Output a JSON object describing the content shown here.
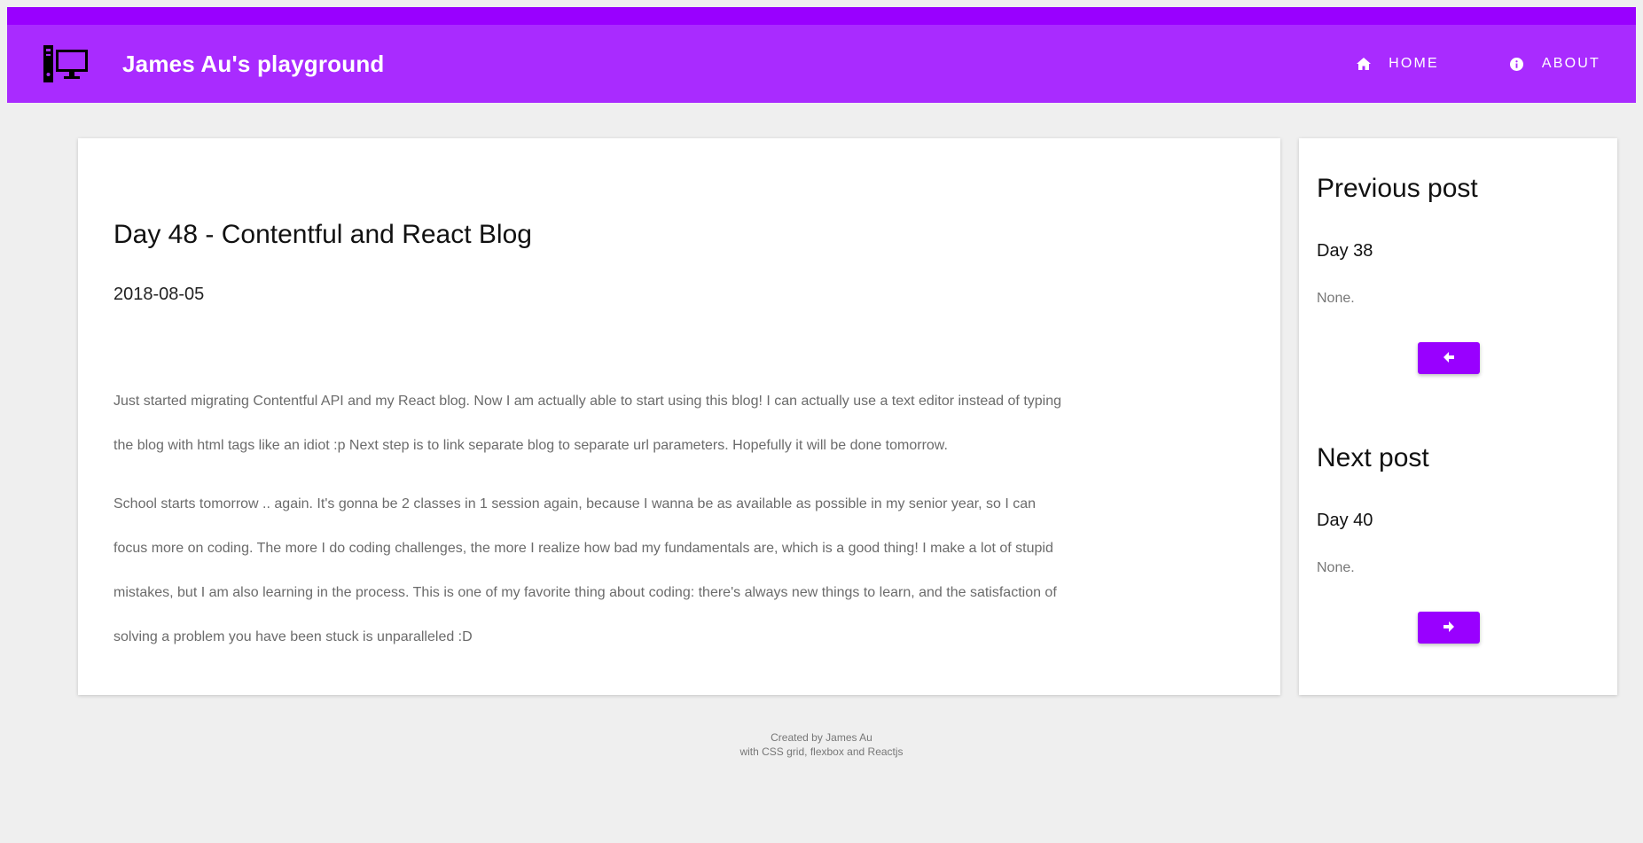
{
  "header": {
    "logo_icon": "desktop-computer-icon",
    "title": "James Au's playground",
    "nav": [
      {
        "label": "HOME",
        "icon": "home-icon"
      },
      {
        "label": "ABOUT",
        "icon": "info-circle-icon"
      }
    ]
  },
  "post": {
    "title": "Day 48 - Contentful and React Blog",
    "date": "2018-08-05",
    "paragraphs": [
      "Just started migrating Contentful API and my React blog. Now I am actually able to start using this blog! I can actually use a text editor instead of typing the blog with html tags like an idiot :p Next step is to link separate blog to separate url parameters. Hopefully it will be done tomorrow.",
      "School starts tomorrow .. again. It's gonna be 2 classes in 1 session again, because I wanna be as available as possible in my senior year, so I can focus more on coding. The more I do coding challenges, the more I realize how bad my fundamentals are, which is a good thing! I make a lot of stupid mistakes, but I am also learning in the process. This is one of my favorite thing about coding: there's always new things to learn, and the satisfaction of solving a problem you have been stuck is unparalleled :D"
    ]
  },
  "sidebar": {
    "previous": {
      "heading": "Previous post",
      "title": "Day 38",
      "summary": "None.",
      "button_icon": "arrow-left-icon"
    },
    "next": {
      "heading": "Next post",
      "title": "Day 40",
      "summary": "None.",
      "button_icon": "arrow-right-icon"
    }
  },
  "footer": {
    "line1": "Created by James Au",
    "line2": "with CSS grid, flexbox and Reactjs"
  },
  "colors": {
    "header_bg": "#a92bff",
    "header_top_bar": "#9900ff",
    "button": "#9900ff",
    "page_bg": "#efefef"
  }
}
